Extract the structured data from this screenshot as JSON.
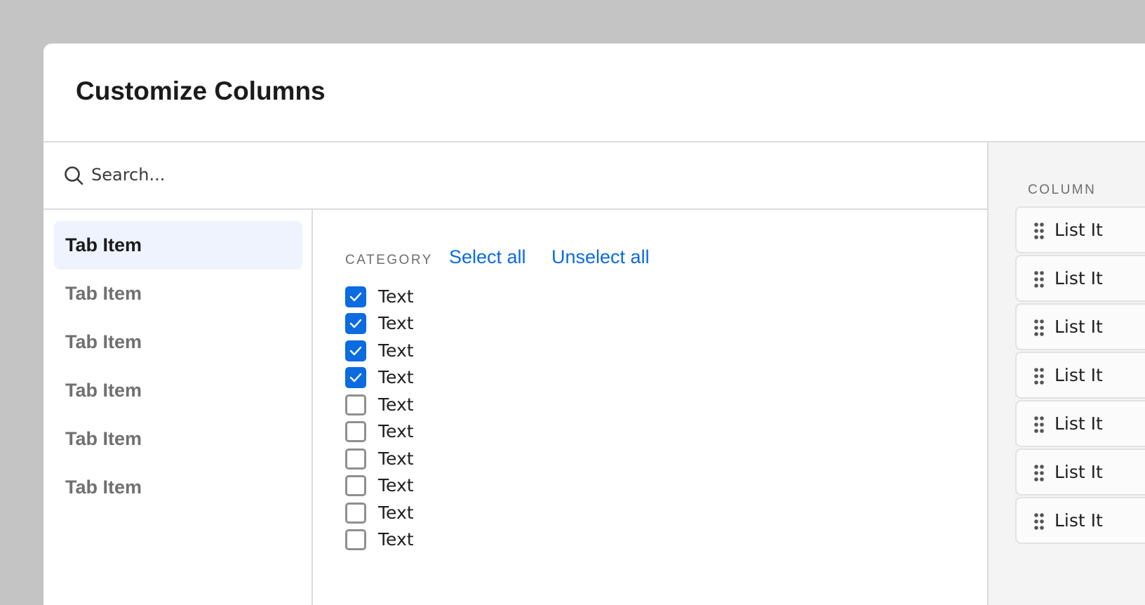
{
  "dialog": {
    "title": "Customize Columns"
  },
  "search": {
    "placeholder": "Search..."
  },
  "tabs": [
    {
      "label": "Tab Item",
      "active": true
    },
    {
      "label": "Tab Item",
      "active": false
    },
    {
      "label": "Tab Item",
      "active": false
    },
    {
      "label": "Tab Item",
      "active": false
    },
    {
      "label": "Tab Item",
      "active": false
    },
    {
      "label": "Tab Item",
      "active": false
    }
  ],
  "category": {
    "label": "CATEGORY",
    "select_all": "Select all",
    "unselect_all": "Unselect all",
    "items": [
      {
        "label": "Text",
        "checked": true
      },
      {
        "label": "Text",
        "checked": true
      },
      {
        "label": "Text",
        "checked": true
      },
      {
        "label": "Text",
        "checked": true
      },
      {
        "label": "Text",
        "checked": false
      },
      {
        "label": "Text",
        "checked": false
      },
      {
        "label": "Text",
        "checked": false
      },
      {
        "label": "Text",
        "checked": false
      },
      {
        "label": "Text",
        "checked": false
      },
      {
        "label": "Text",
        "checked": false
      }
    ]
  },
  "columns": {
    "label": "COLUMN",
    "items": [
      {
        "label": "List It"
      },
      {
        "label": "List It"
      },
      {
        "label": "List It"
      },
      {
        "label": "List It"
      },
      {
        "label": "List It"
      },
      {
        "label": "List It"
      },
      {
        "label": "List It"
      }
    ]
  },
  "colors": {
    "accent": "#0b6be0",
    "active_tab_bg": "#eef3fd",
    "backdrop": "#c4c4c4"
  }
}
